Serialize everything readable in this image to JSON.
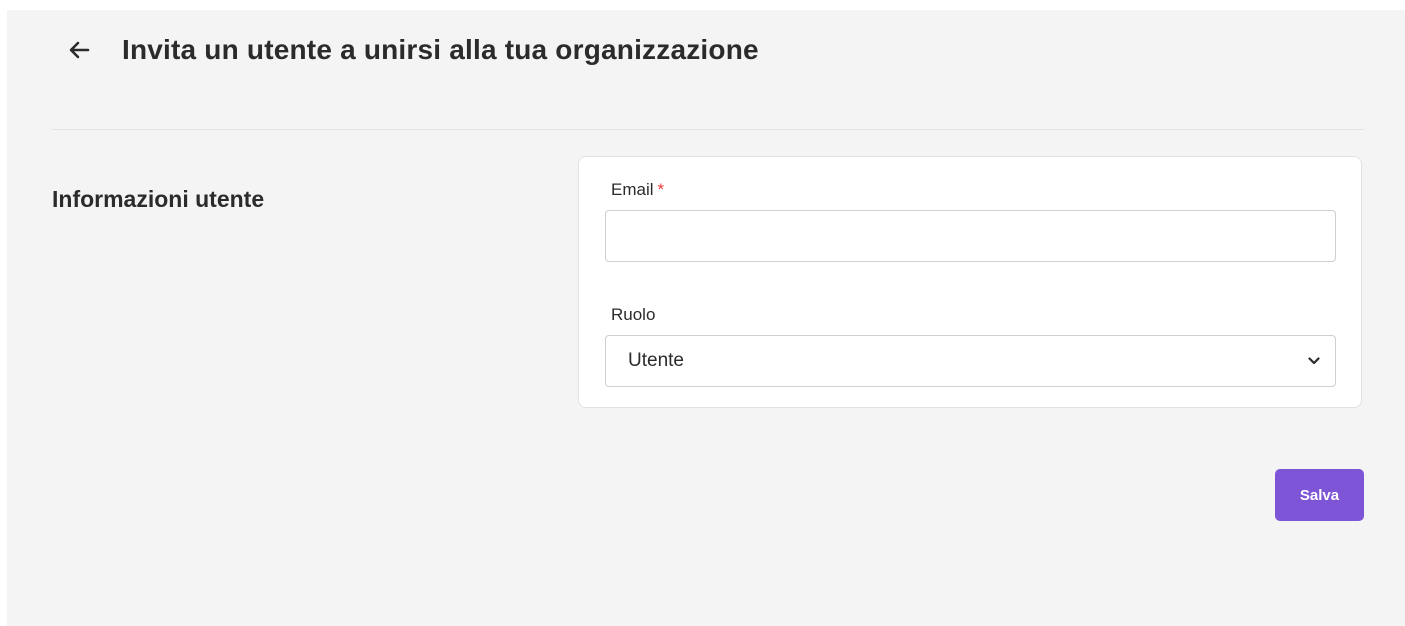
{
  "header": {
    "title": "Invita un utente a unirsi alla tua organizzazione",
    "back_icon": "arrow-left-icon"
  },
  "section": {
    "title": "Informazioni utente"
  },
  "form": {
    "email": {
      "label": "Email",
      "required_mark": "*",
      "value": "",
      "placeholder": ""
    },
    "role": {
      "label": "Ruolo",
      "selected": "Utente",
      "icon": "chevron-down-icon"
    }
  },
  "actions": {
    "save_label": "Salva"
  },
  "colors": {
    "background": "#f4f4f4",
    "card": "#ffffff",
    "accent": "#7e55d7",
    "required": "#e53935",
    "text": "#2b2b2b"
  }
}
